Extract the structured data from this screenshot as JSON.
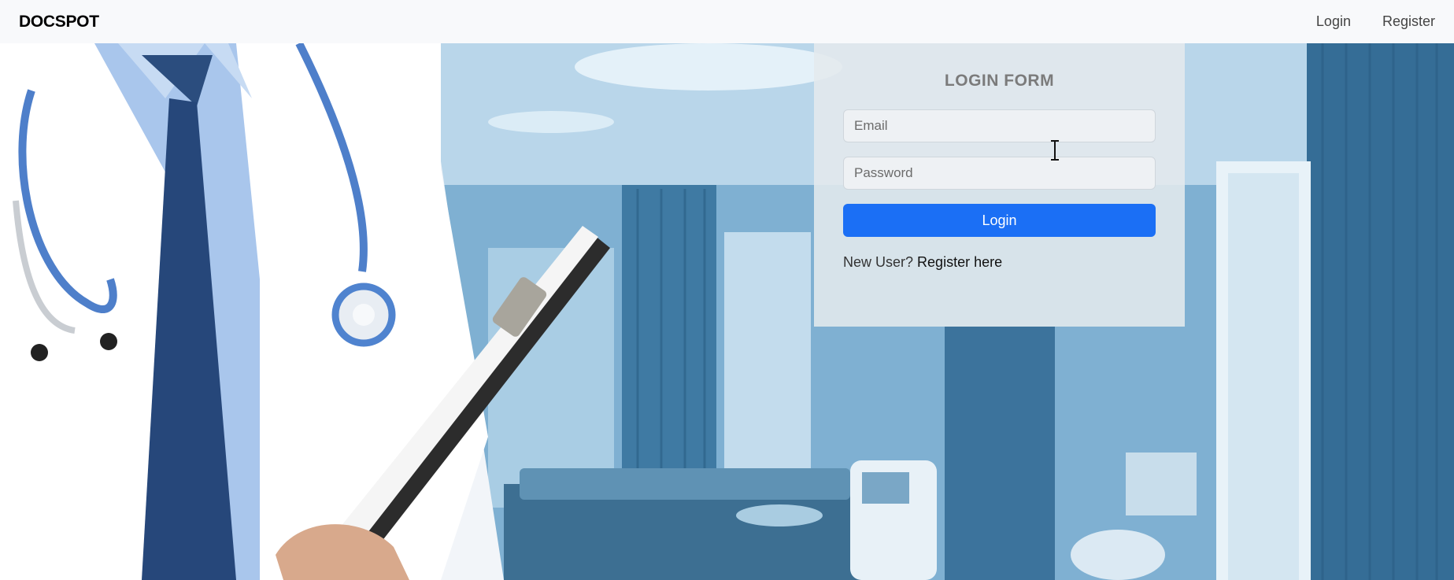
{
  "navbar": {
    "brand": "DOCSPOT",
    "links": [
      {
        "label": "Login"
      },
      {
        "label": "Register"
      }
    ]
  },
  "login_form": {
    "title": "LOGIN FORM",
    "email_placeholder": "Email",
    "password_placeholder": "Password",
    "submit_label": "Login",
    "new_user_text": "New User?",
    "register_link_label": "Register here"
  },
  "colors": {
    "primary": "#1b6ff5",
    "navbar_bg": "#f8f9fb",
    "card_bg": "#e4e9ed"
  },
  "icons": {
    "cursor": "text-cursor-icon"
  }
}
